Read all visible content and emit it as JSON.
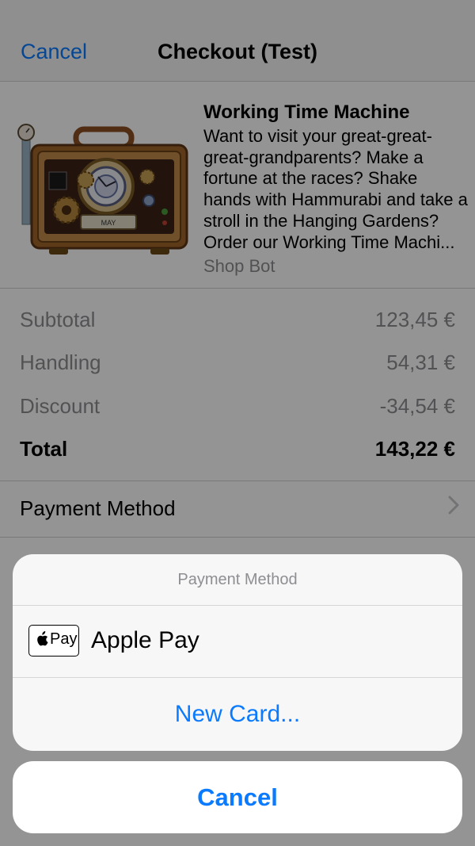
{
  "nav": {
    "cancel_label": "Cancel",
    "title": "Checkout (Test)"
  },
  "product": {
    "title": "Working Time Machine",
    "description": "Want to visit your great-great-great-grandparents? Make a fortune at the races? Shake hands with Hammurabi and take a stroll in the Hanging Gardens? Order our Working Time Machi...",
    "seller": "Shop Bot",
    "image_label": "MAY"
  },
  "summary": {
    "rows": [
      {
        "label": "Subtotal",
        "value": "123,45 €"
      },
      {
        "label": "Handling",
        "value": "54,31 €"
      },
      {
        "label": "Discount",
        "value": "-34,54 €"
      }
    ],
    "total": {
      "label": "Total",
      "value": "143,22 €"
    }
  },
  "payment_row": {
    "label": "Payment Method"
  },
  "action_sheet": {
    "title": "Payment Method",
    "apple_pay_mark": "Pay",
    "apple_pay_label": "Apple Pay",
    "new_card_label": "New Card...",
    "cancel_label": "Cancel"
  },
  "colors": {
    "accent": "#0a7aff",
    "secondary_text": "#8e8e93",
    "overlay": "rgba(0,0,0,0.42)"
  }
}
